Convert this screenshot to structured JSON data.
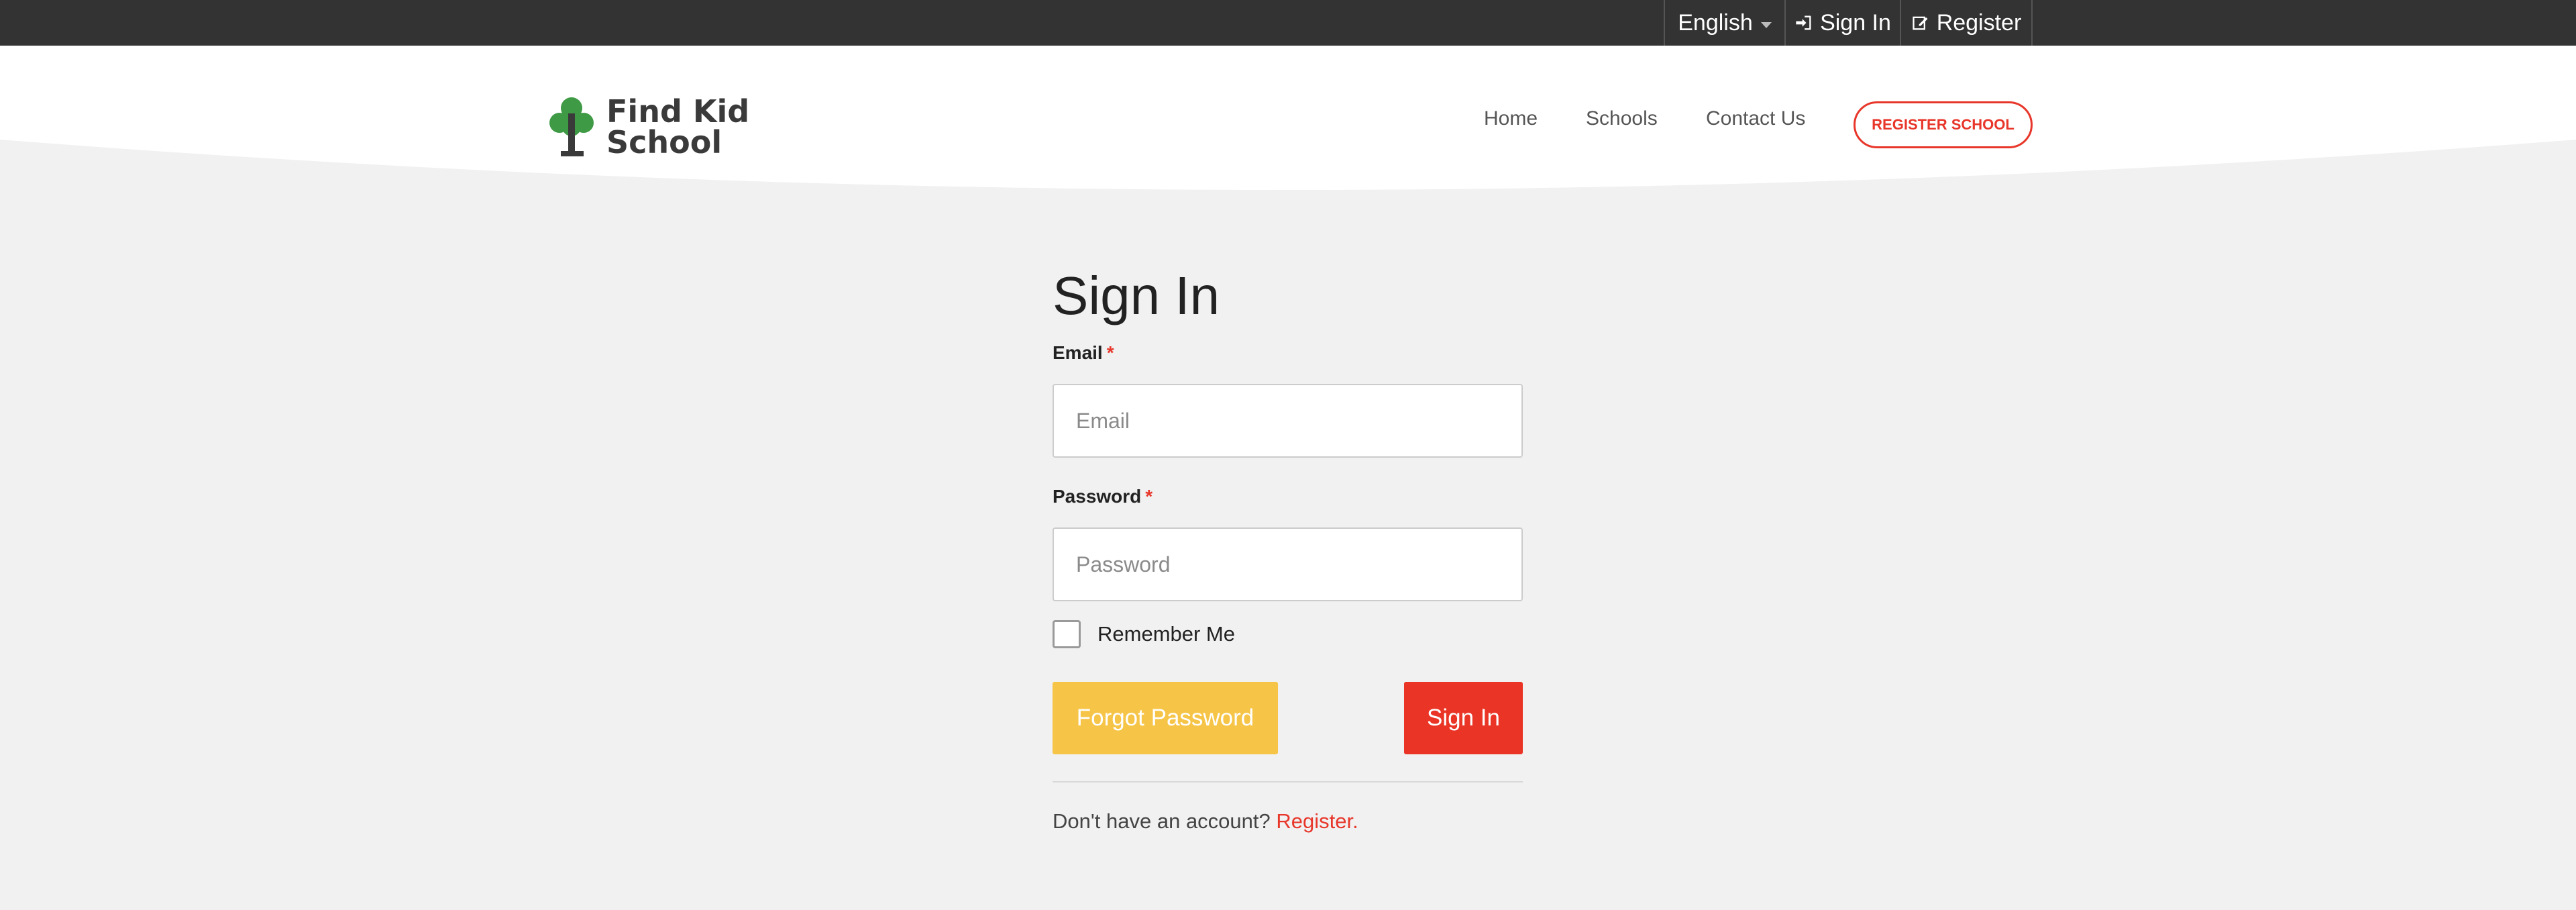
{
  "topbar": {
    "language": "English",
    "sign_in": "Sign In",
    "register": "Register"
  },
  "header": {
    "logo_line1": "Find Kid",
    "logo_line2": "School",
    "nav": {
      "home": "Home",
      "schools": "Schools",
      "contact": "Contact Us"
    },
    "register_school": "REGISTER SCHOOL"
  },
  "form": {
    "title": "Sign In",
    "email_label": "Email",
    "email_placeholder": "Email",
    "email_value": "",
    "password_label": "Password",
    "password_placeholder": "Password",
    "password_value": "",
    "required_mark": "*",
    "remember_me": "Remember Me",
    "remember_checked": false,
    "forgot_password": "Forgot Password",
    "sign_in": "Sign In",
    "no_account": "Don't have an account?",
    "register_link": "Register."
  },
  "colors": {
    "topbar_bg": "#333333",
    "accent_red": "#e8362a",
    "forgot_yellow": "#f6c446",
    "logo_green": "#3f9a45",
    "page_bg": "#f1f1f1"
  },
  "icons": {
    "language_caret": "chevron-down-icon",
    "sign_in": "sign-in-icon",
    "register": "edit-icon",
    "logo": "tree-icon"
  }
}
